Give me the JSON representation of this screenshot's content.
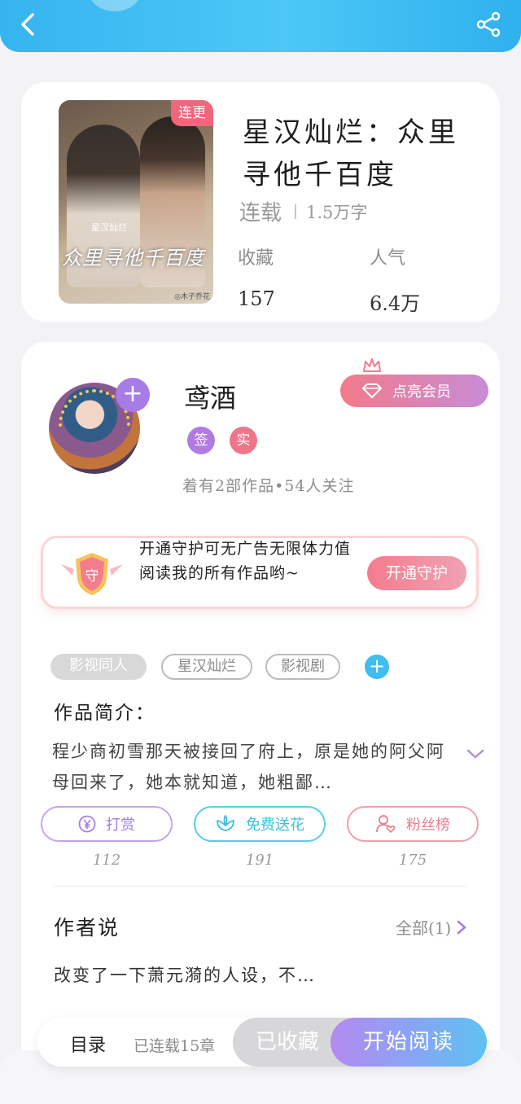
{
  "header": {
    "back_icon": "chevron-left-icon",
    "share_icon": "share-icon"
  },
  "book": {
    "title": "星汉灿烂：众里寻他千百度",
    "cover_badge": "连更",
    "cover_subtitle": "星汉灿烂",
    "cover_title": "众里寻他千百度",
    "cover_credit": "◎木子乔花",
    "status": "连载",
    "word_count": "1.5万字",
    "stats": [
      {
        "label": "收藏",
        "value": "157"
      },
      {
        "label": "人气",
        "value": "6.4万"
      }
    ]
  },
  "author": {
    "name": "鸢酒",
    "vip_label": "点亮会员",
    "badge_sign": "签",
    "badge_real": "实",
    "stats": "着有2部作品•54人关注"
  },
  "guard": {
    "text": "开通守护可无广告无限体力值阅读我的所有作品哟~",
    "shield_label": "守",
    "button": "开通守护"
  },
  "tags": [
    "影视同人",
    "星汉灿烂",
    "影视剧"
  ],
  "intro": {
    "heading": "作品简介：",
    "text": "程少商初雪那天被接回了府上，原是她的阿父阿母回来了，她本就知道，她粗鄙…"
  },
  "actions": [
    {
      "label": "打赏",
      "count": "112",
      "icon": "yen-icon"
    },
    {
      "label": "免费送花",
      "count": "191",
      "icon": "flower-icon"
    },
    {
      "label": "粉丝榜",
      "count": "175",
      "icon": "user-heart-icon"
    }
  ],
  "author_says": {
    "heading": "作者说",
    "all_label": "全部(1)",
    "text": "改变了一下萧元漪的人设，不…"
  },
  "bottom": {
    "toc": "目录",
    "status": "已连载15章",
    "collected": "已收藏",
    "read": "开始阅读"
  },
  "colors": {
    "header": "#35b4ef",
    "accent_purple": "#a77ce6",
    "accent_pink": "#f0758a",
    "accent_cyan": "#3bbfe0"
  }
}
